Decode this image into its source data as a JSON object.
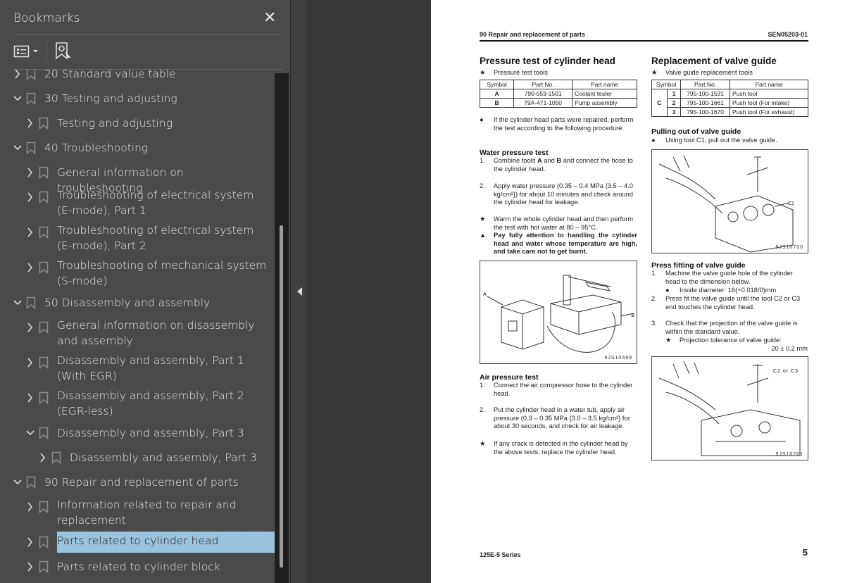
{
  "panel": {
    "title": "Bookmarks",
    "close_icon": "close-icon",
    "options_icon": "list-options-icon",
    "find_icon": "find-bookmark-icon"
  },
  "bookmarks": [
    {
      "level": 0,
      "expanded": false,
      "label": "20 Standard value table"
    },
    {
      "level": 0,
      "expanded": true,
      "label": "30 Testing and adjusting"
    },
    {
      "level": 1,
      "expanded": false,
      "label": "Testing and adjusting"
    },
    {
      "level": 0,
      "expanded": true,
      "label": "40 Troubleshooting"
    },
    {
      "level": 1,
      "expanded": false,
      "label": "General information on troubleshooting"
    },
    {
      "level": 1,
      "expanded": false,
      "label": "Troubleshooting of electrical system (E-mode), Part 1",
      "two": true
    },
    {
      "level": 1,
      "expanded": false,
      "label": "Troubleshooting of electrical system (E-mode), Part 2",
      "two": true
    },
    {
      "level": 1,
      "expanded": false,
      "label": "Troubleshooting of mechanical system (S-mode)",
      "two": true
    },
    {
      "level": 0,
      "expanded": true,
      "label": "50 Disassembly and assembly"
    },
    {
      "level": 1,
      "expanded": false,
      "label": "General information on disassembly and assembly",
      "two": true
    },
    {
      "level": 1,
      "expanded": false,
      "label": "Disassembly and assembly, Part 1 (With EGR)",
      "two": true
    },
    {
      "level": 1,
      "expanded": false,
      "label": "Disassembly and assembly, Part 2 (EGR-less)",
      "two": true
    },
    {
      "level": 1,
      "expanded": true,
      "label": "Disassembly and assembly, Part 3"
    },
    {
      "level": 2,
      "expanded": false,
      "label": "Disassembly and assembly, Part 3"
    },
    {
      "level": 0,
      "expanded": true,
      "label": "90 Repair and replacement of parts"
    },
    {
      "level": 1,
      "expanded": false,
      "label": "Information related to repair and replacement",
      "two": true
    },
    {
      "level": 1,
      "expanded": false,
      "label": "Parts related to cylinder head",
      "selected": true
    },
    {
      "level": 1,
      "expanded": false,
      "label": "Parts related to cylinder block"
    }
  ],
  "colors": {
    "selection": "#9cc3dd",
    "panel": "#4a4a4a",
    "viewer": "#383838"
  },
  "doc": {
    "header_left": "90 Repair and replacement of parts",
    "header_right": "SEN05203-01",
    "footer_left": "125E-5 Series",
    "page_number": "5",
    "left": {
      "title": "Pressure test of cylinder head",
      "tools_caption": "Pressure test tools",
      "table_headers": [
        "Symbol",
        "Part No.",
        "Part name"
      ],
      "table_rows": [
        [
          "A",
          "790-553-1501",
          "Coolant tester"
        ],
        [
          "B",
          "79A-471-1050",
          "Pump assembly"
        ]
      ],
      "note": "If the cylinder head parts were repaired, perform the test according to the following procedure.",
      "water_title": "Water pressure test",
      "water_1a": "Combine tools ",
      "water_1b": "A",
      "water_1c": " and ",
      "water_1d": "B",
      "water_1e": " and connect the hose to the cylinder head.",
      "water_2": "Apply water pressure (0.35 – 0.4 MPa {3.5 – 4.0 kg/cm²}) for about 10 minutes and check around the cylinder head for leakage.",
      "water_star": "Warm the whole cylinder head and then perform the test with hot water at 80 – 95°C.",
      "warning": "Pay fully attention to handling the cylinder head and water whose temperature are high, and take care not to get burnt.",
      "fig_label_a": "A",
      "fig_label_b": "B",
      "fig_code": "9JS10699",
      "air_title": "Air pressure test",
      "air_1": "Connect the air compressor hose to the cylinder head.",
      "air_2": "Put the cylinder head in a water tub, apply air pressure (0.3 – 0.35 MPa {3.0 – 3.5 kg/cm²} for about 30 seconds, and check for air leakage.",
      "air_star": "If any crack is detected in the cylinder head by the above tests, replace the cylinder head."
    },
    "right": {
      "title": "Replacement of valve guide",
      "tools_caption": "Valve guide replacement tools",
      "table_headers": [
        "Symbol",
        "Part No.",
        "Part name"
      ],
      "table_group": "C",
      "table_rows": [
        [
          "1",
          "795-100-1531",
          "Push tool"
        ],
        [
          "2",
          "795-100-1661",
          "Push tool (For intake)"
        ],
        [
          "3",
          "795-100-1670",
          "Push tool (For exhaust)"
        ]
      ],
      "pull_title": "Pulling out of valve guide",
      "pull_text": "Using tool C1, pull out the valve guide.",
      "fig1_label": "C1",
      "fig1_code": "9JS10700",
      "press_title": "Press fitting of valve guide",
      "press_1": "Machine the valve guide hole of the cylinder head to the dimension below.",
      "press_1b": "Inside diameter: 16(+0.018/0)mm",
      "press_2": "Press fit the valve guide until the tool C2 or C3 end touches the cylinder head.",
      "press_3": "Check that the projection of the valve guide is within the standard value.",
      "press_star": "Projection tolerance of valve guide:",
      "press_value": "20 ± 0.2 mm",
      "fig2_label": "C2 or C3",
      "fig2_code": "9JS10701"
    }
  }
}
